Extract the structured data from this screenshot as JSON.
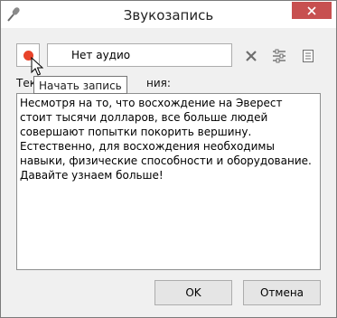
{
  "window": {
    "title": "Звукозапись",
    "app_icon": "microphone-icon",
    "close_icon": "close-icon"
  },
  "toolbar": {
    "record_icon": "record-icon",
    "audio_value": "Нет аудио",
    "clear_icon": "clear-icon",
    "settings_icon": "audio-settings-icon",
    "notes_icon": "notes-icon"
  },
  "tooltip": {
    "text": "Начать запись"
  },
  "editor": {
    "label_visible_prefix": "Тек",
    "label_visible_suffix": "ния:",
    "text": "Несмотря на то, что восхождение на Эверест стоит тысячи долларов, все больше людей совершают попытки покорить вершину. Естественно, для восхождения необходимы навыки, физические способности и оборудование. Давайте узнаем больше!"
  },
  "buttons": {
    "ok": "OK",
    "cancel": "Отмена"
  },
  "colors": {
    "record": "#e8432a",
    "close": "#c75050"
  }
}
